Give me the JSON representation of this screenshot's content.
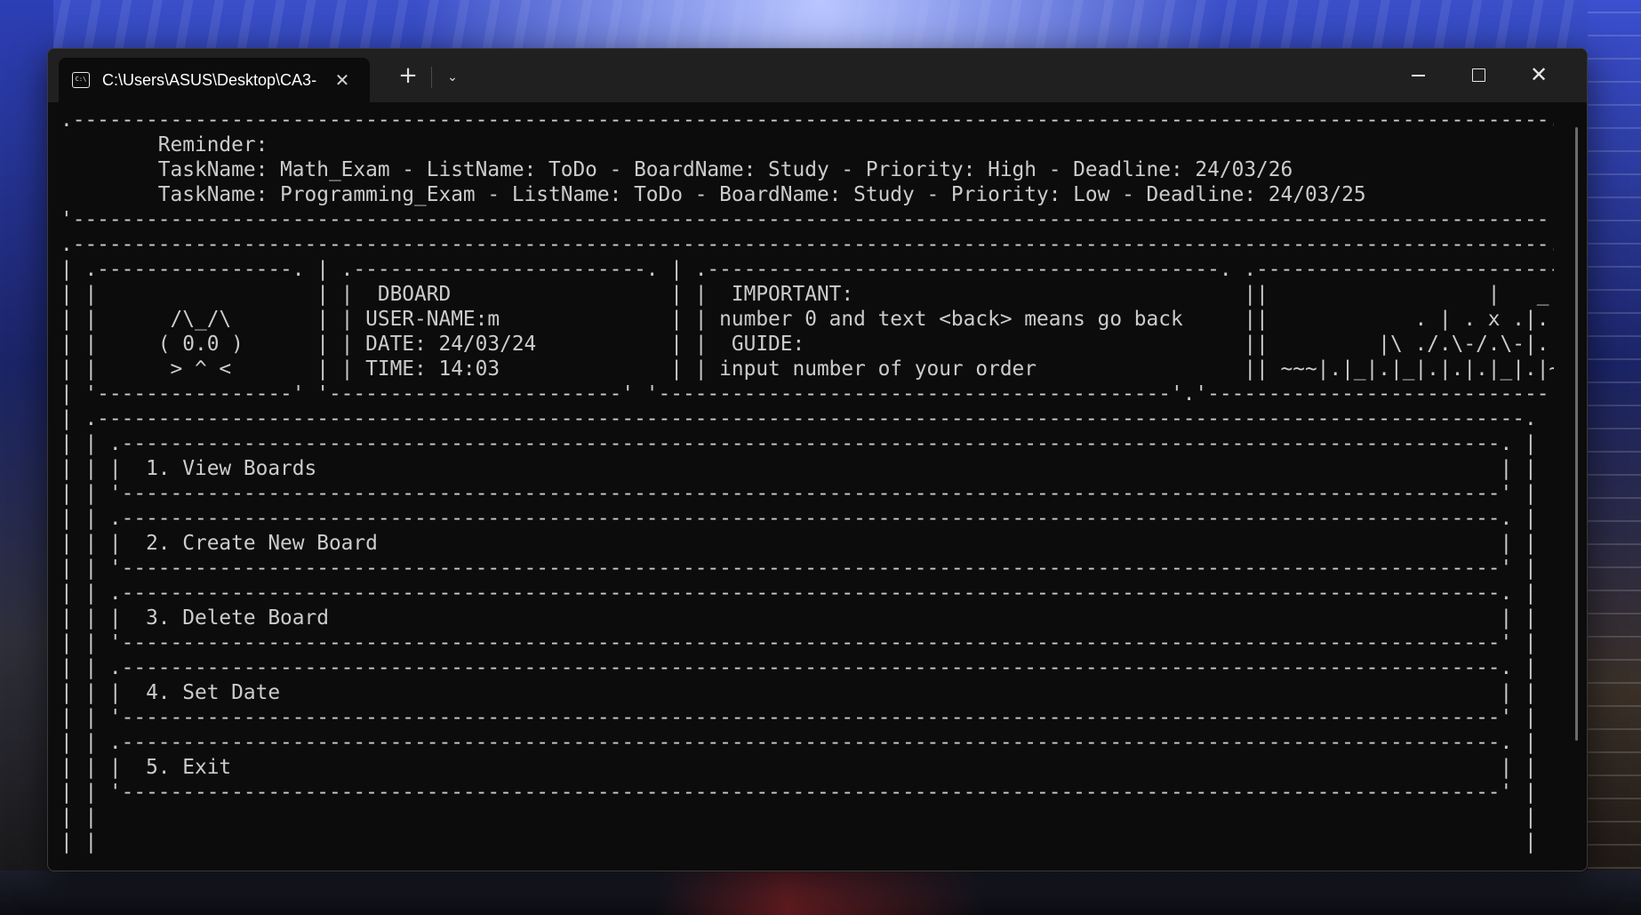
{
  "titlebar": {
    "tab_title": "C:\\Users\\ASUS\\Desktop\\CA3-",
    "tab_icon": "terminal-icon",
    "tab_icon_glyph": "C:\\",
    "close_tab_glyph": "✕",
    "new_tab_glyph": "+",
    "dropdown_glyph": "⌄",
    "close_window_glyph": "✕"
  },
  "console": {
    "reminder": {
      "heading": "Reminder:",
      "tasks": [
        "TaskName: Math_Exam - ListName: ToDo - BoardName: Study - Priority: High - Deadline: 24/03/26",
        "TaskName: Programming_Exam - ListName: ToDo - BoardName: Study - Priority: Low - Deadline: 24/03/25"
      ]
    },
    "mascot": [
      "/\\_/\\",
      "( 0.0 )",
      "> ^ <"
    ],
    "info": {
      "app_name": "DBOARD",
      "username": "USER-NAME:m",
      "date": "DATE: 24/03/24",
      "time": "TIME: 14:03"
    },
    "help": {
      "important_label": "IMPORTANT:",
      "important_text": "number 0 and text <back> means go back",
      "guide_label": "GUIDE:",
      "guide_text": "input number of your order"
    },
    "art": [
      "|   _   _",
      ". | . x .|.|-|.|",
      "|\\ ./.\\-/.\\-|.|.|.|",
      "~~~|.|_|.|_|.|.|.|_|.|~~~"
    ],
    "menu": [
      "1. View Boards",
      "2. Create New Board",
      "3. Delete Board",
      "4. Set Date",
      "5. Exit"
    ]
  },
  "colors": {
    "console_bg": "#0c0c0c",
    "console_text": "#cccccc",
    "titlebar_bg": "#202020"
  }
}
